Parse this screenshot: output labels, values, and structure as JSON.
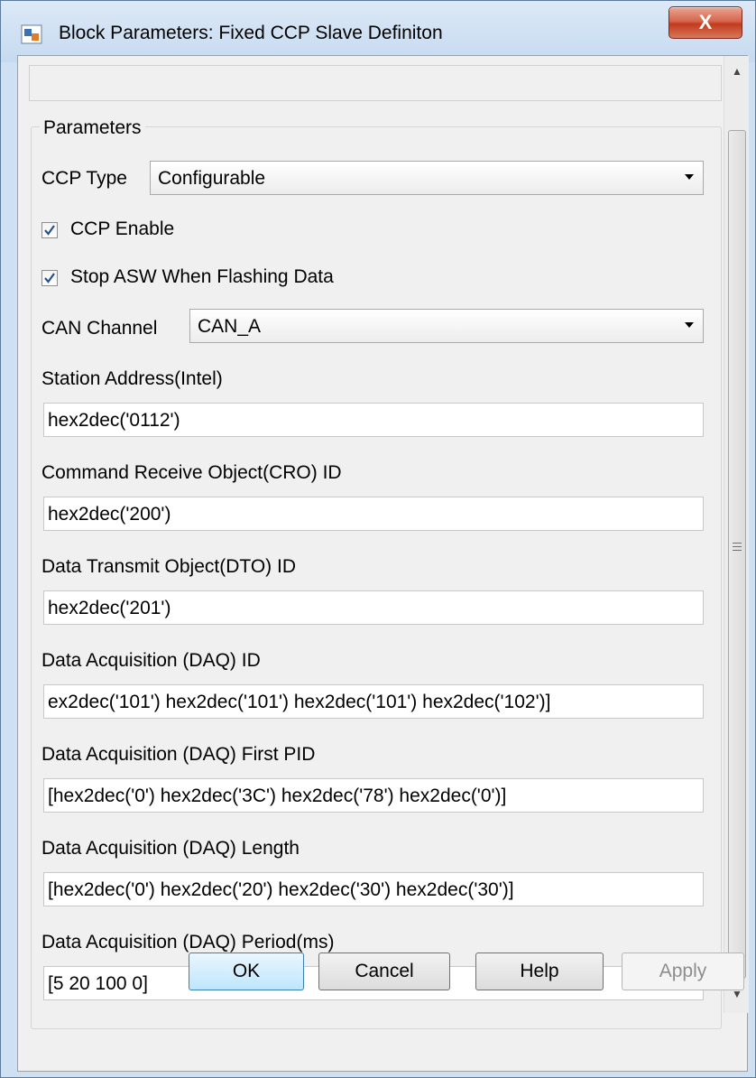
{
  "window": {
    "title": "Block Parameters: Fixed CCP Slave Definiton",
    "close_label": "X"
  },
  "group": {
    "label": "Parameters"
  },
  "ccp_type": {
    "label": "CCP Type",
    "value": "Configurable"
  },
  "ccp_enable": {
    "label": "CCP Enable",
    "checked": true
  },
  "stop_asw": {
    "label": "Stop ASW When Flashing Data",
    "checked": true
  },
  "can_channel": {
    "label": "CAN Channel",
    "value": "CAN_A"
  },
  "fields": [
    {
      "label": "Station Address(Intel)",
      "value": "hex2dec('0112')"
    },
    {
      "label": "Command Receive Object(CRO) ID",
      "value": "hex2dec('200')"
    },
    {
      "label": "Data Transmit Object(DTO) ID",
      "value": "hex2dec('201')"
    },
    {
      "label": "Data Acquisition (DAQ) ID",
      "value": "ex2dec('101') hex2dec('101') hex2dec('101') hex2dec('102')]"
    },
    {
      "label": "Data Acquisition (DAQ) First PID",
      "value": "[hex2dec('0') hex2dec('3C') hex2dec('78') hex2dec('0')]"
    },
    {
      "label": "Data Acquisition (DAQ) Length",
      "value": "[hex2dec('0') hex2dec('20') hex2dec('30') hex2dec('30')]"
    },
    {
      "label": "Data Acquisition (DAQ) Period(ms)",
      "value": "[5 20 100 0]"
    }
  ],
  "buttons": {
    "ok": "OK",
    "cancel": "Cancel",
    "help": "Help",
    "apply": "Apply"
  },
  "icons": {
    "app": "simulink-block-icon",
    "check": "checkmark-icon",
    "dropdown": "chevron-down-icon"
  },
  "colors": {
    "title_bg": "#c6daf0",
    "close_red": "#c23b1e",
    "checkmark": "#2a4f8a",
    "default_button": "#bee6fd"
  }
}
